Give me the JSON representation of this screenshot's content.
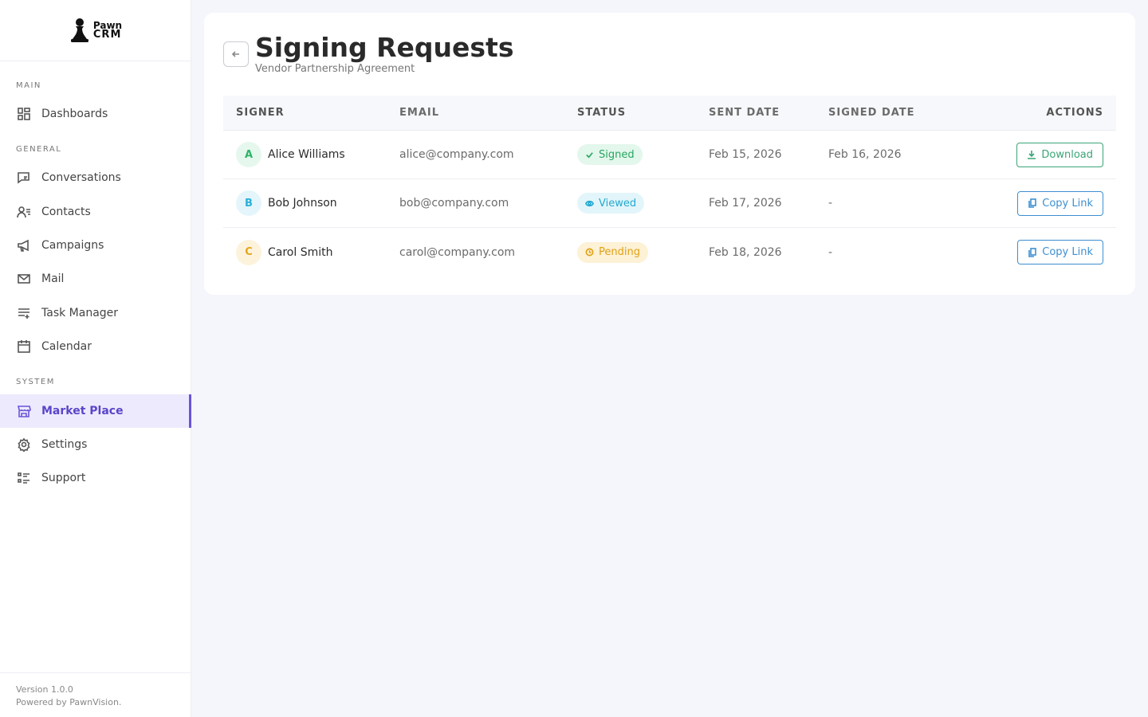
{
  "brand": {
    "line1": "Pawn",
    "line2": "CRM"
  },
  "sidebar": {
    "sections": [
      {
        "label": "MAIN",
        "items": [
          {
            "label": "Dashboards",
            "icon": "dashboard-icon",
            "active": false
          }
        ]
      },
      {
        "label": "GENERAL",
        "items": [
          {
            "label": "Conversations",
            "icon": "conversations-icon",
            "active": false
          },
          {
            "label": "Contacts",
            "icon": "contacts-icon",
            "active": false
          },
          {
            "label": "Campaigns",
            "icon": "megaphone-icon",
            "active": false
          },
          {
            "label": "Mail",
            "icon": "mail-icon",
            "active": false
          },
          {
            "label": "Task Manager",
            "icon": "task-list-icon",
            "active": false
          },
          {
            "label": "Calendar",
            "icon": "calendar-icon",
            "active": false
          }
        ]
      },
      {
        "label": "SYSTEM",
        "items": [
          {
            "label": "Market Place",
            "icon": "store-icon",
            "active": true
          },
          {
            "label": "Settings",
            "icon": "gear-icon",
            "active": false
          },
          {
            "label": "Support",
            "icon": "support-list-icon",
            "active": false
          }
        ]
      }
    ],
    "footer": {
      "version": "Version 1.0.0",
      "powered_by": "Powered by PawnVision."
    }
  },
  "main": {
    "title": "Signing Requests",
    "subtitle": "Vendor Partnership Agreement",
    "columns": [
      "SIGNER",
      "EMAIL",
      "STATUS",
      "SENT DATE",
      "SIGNED DATE",
      "ACTIONS"
    ],
    "rows": [
      {
        "initial": "A",
        "name": "Alice Williams",
        "email": "alice@company.com",
        "status": "Signed",
        "status_icon": "check-icon",
        "sent": "Feb 15, 2026",
        "signed": "Feb 16, 2026",
        "action": "Download",
        "action_icon": "download-icon",
        "avatar_bg": "#e6f8ee",
        "avatar_fg": "#2fb36a",
        "badge_bg": "#e3f7ec",
        "badge_fg": "#28a65f",
        "action_color": "#3aa577"
      },
      {
        "initial": "B",
        "name": "Bob Johnson",
        "email": "bob@company.com",
        "status": "Viewed",
        "status_icon": "eye-icon",
        "sent": "Feb 17, 2026",
        "signed": "-",
        "action": "Copy Link",
        "action_icon": "copy-icon",
        "avatar_bg": "#e4f6fb",
        "avatar_fg": "#2bb0d6",
        "badge_bg": "#e2f5fb",
        "badge_fg": "#23a9d0",
        "action_color": "#3d8fd1"
      },
      {
        "initial": "C",
        "name": "Carol Smith",
        "email": "carol@company.com",
        "status": "Pending",
        "status_icon": "clock-icon",
        "sent": "Feb 18, 2026",
        "signed": "-",
        "action": "Copy Link",
        "action_icon": "copy-icon",
        "avatar_bg": "#fdf3dc",
        "avatar_fg": "#e3a51a",
        "badge_bg": "#fdf1d6",
        "badge_fg": "#e0a114",
        "action_color": "#3d8fd1"
      }
    ]
  }
}
